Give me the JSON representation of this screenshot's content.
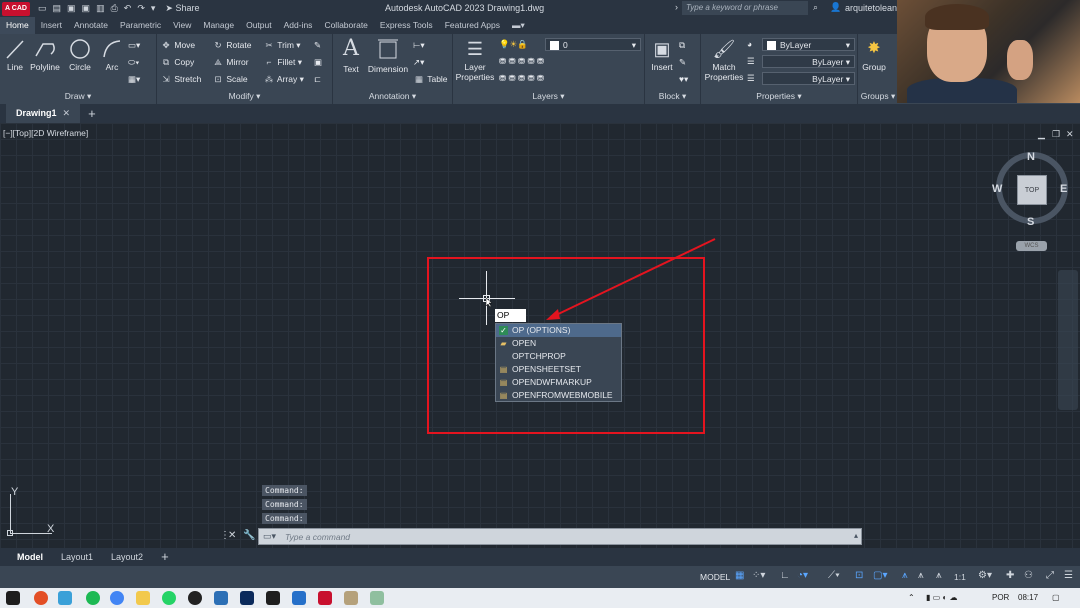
{
  "titlebar": {
    "app_badge": "A CAD",
    "share": "Share",
    "title": "Autodesk AutoCAD 2023    Drawing1.dwg",
    "search_placeholder": "Type a keyword or phrase",
    "user": "arquitetolean..."
  },
  "ribbon_tabs": [
    "Home",
    "Insert",
    "Annotate",
    "Parametric",
    "View",
    "Manage",
    "Output",
    "Add-ins",
    "Collaborate",
    "Express Tools",
    "Featured Apps"
  ],
  "draw_panel": {
    "title": "Draw",
    "line": "Line",
    "polyline": "Polyline",
    "circle": "Circle",
    "arc": "Arc"
  },
  "modify_panel": {
    "title": "Modify",
    "move": "Move",
    "rotate": "Rotate",
    "trim": "Trim",
    "copy": "Copy",
    "mirror": "Mirror",
    "fillet": "Fillet",
    "stretch": "Stretch",
    "scale": "Scale",
    "array": "Array"
  },
  "annotation_panel": {
    "title": "Annotation",
    "text": "Text",
    "dimension": "Dimension",
    "table": "Table"
  },
  "layers_panel": {
    "title": "Layers",
    "layer_properties_1": "Layer",
    "layer_properties_2": "Properties",
    "current_layer": "0"
  },
  "block_panel": {
    "title": "Block",
    "insert": "Insert"
  },
  "properties_panel": {
    "title": "Properties",
    "match_1": "Match",
    "match_2": "Properties",
    "color": "ByLayer",
    "linetype": "ByLayer",
    "lineweight": "ByLayer"
  },
  "groups_panel": {
    "title": "Groups",
    "group": "Group"
  },
  "file_tab": {
    "name": "Drawing1",
    "close": "✕",
    "add": "+"
  },
  "viewport": {
    "label": "[−][Top][2D Wireframe]",
    "min": "▁",
    "restore": "❐",
    "close": "✕"
  },
  "viewcube": {
    "n": "N",
    "s": "S",
    "e": "E",
    "w": "W",
    "face": "TOP",
    "wcs": "WCS"
  },
  "dynamic_input": {
    "value": "OP"
  },
  "autocomplete": [
    {
      "label": "OP (OPTIONS)",
      "icon": "check-icon"
    },
    {
      "label": "OPEN",
      "icon": "folder-icon"
    },
    {
      "label": "OPTCHPROP",
      "icon": ""
    },
    {
      "label": "OPENSHEETSET",
      "icon": "sheetset-icon"
    },
    {
      "label": "OPENDWFMARKUP",
      "icon": "markup-icon"
    },
    {
      "label": "OPENFROMWEBMOBILE",
      "icon": "web-icon"
    }
  ],
  "ucs": {
    "x": "X",
    "y": "Y"
  },
  "command_history": [
    "Command:",
    "Command:",
    "Command:"
  ],
  "command_line": {
    "placeholder": "Type  a  command"
  },
  "layout_tabs": [
    "Model",
    "Layout1",
    "Layout2",
    "+"
  ],
  "status": {
    "model": "MODEL",
    "scale": "1:1"
  },
  "taskbar": {
    "lang": "POR",
    "time": "08:17"
  },
  "colors": {
    "accent_red": "#e4141f",
    "selected": "#4e6a8c",
    "autocad_red": "#c8102e"
  }
}
